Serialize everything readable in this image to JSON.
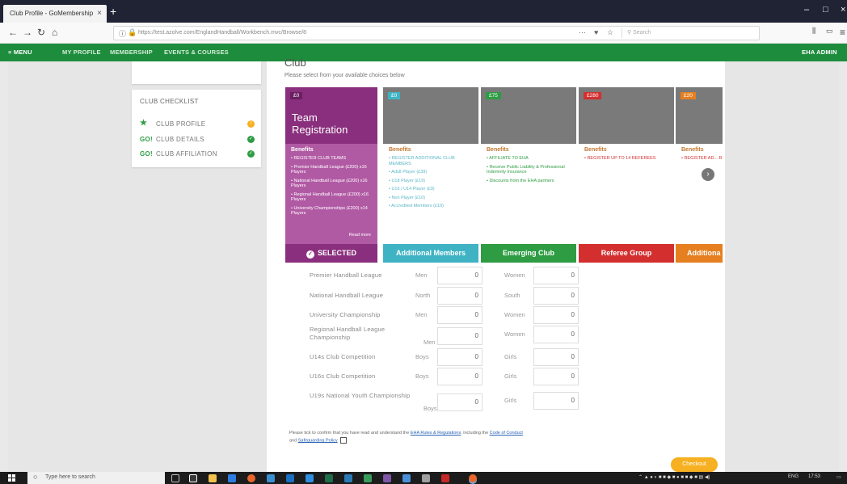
{
  "browser": {
    "tab_title": "Club Profile - GoMembership",
    "url": "https://test.azolve.com/EnglandHandball/Workbench.mvc/Browse/8",
    "search_placeholder": "Search"
  },
  "site_nav": {
    "menu": "MENU",
    "items": [
      "MY PROFILE",
      "MEMBERSHIP",
      "EVENTS & COURSES"
    ],
    "user": "EHA ADMIN"
  },
  "checklist": {
    "title": "CLUB CHECKLIST",
    "items": [
      {
        "icon": "★",
        "label": "CLUB PROFILE",
        "status": "warning",
        "color": "#f6b021"
      },
      {
        "icon": "GO!",
        "label": "CLUB DETAILS",
        "status": "ok",
        "color": "#2e9c43"
      },
      {
        "icon": "GO!",
        "label": "CLUB AFFILIATION",
        "status": "ok",
        "color": "#2e9c43"
      }
    ]
  },
  "main": {
    "heading": "Club",
    "subheading": "Please select from your available choices below"
  },
  "cards": {
    "team": {
      "price": "£0",
      "title_line1": "Team",
      "title_line2": "Registration",
      "benefits_heading": "Benefits",
      "benefits": [
        "• REGISTER CLUB TEAMS",
        "• Premier Handball League (£200) x16 Players",
        "• National Handball League (£200) x16 Players",
        "• Regional Handball League (£200) x16 Players",
        "• University Championships (£200) x14 Players"
      ],
      "read_more": "Read more",
      "footer": "SELECTED"
    },
    "additional": {
      "price": "£0",
      "benefits_heading": "Benefits",
      "benefits": [
        "• REGISTER ADDITIONAL CLUB MEMBERS",
        "• Adult Player (£39)",
        "• U18 Player (£19)",
        "• U16 / U14 Player (£9)",
        "• Non Player (£10)",
        "• Accredited Members (£10)"
      ],
      "footer": "Additional Members"
    },
    "emerging": {
      "price": "£75",
      "benefits_heading": "Benefits",
      "benefits": [
        "• AFFILIATE TO EHA",
        "• Receive Public Liability & Professional Indemnity Insurance",
        "• Discounts from the EHA partners"
      ],
      "footer": "Emerging Club"
    },
    "referee": {
      "price": "£280",
      "benefits_heading": "Benefits",
      "benefits": [
        "• REGISTER UP TO 14 REFEREES"
      ],
      "footer": "Referee Group"
    },
    "additional2": {
      "price": "£20",
      "benefits_heading": "Benefits",
      "benefits": [
        "• REGISTER AD... REFEREES"
      ],
      "footer": "Additiona"
    }
  },
  "form": {
    "rows": [
      {
        "label": "Premier Handball League",
        "sub1": "Men",
        "val1": "0",
        "sub2": "Women",
        "val2": "0"
      },
      {
        "label": "National Handball League",
        "sub1": "North",
        "val1": "0",
        "sub2": "South",
        "val2": "0"
      },
      {
        "label": "University Championship",
        "sub1": "Men",
        "val1": "0",
        "sub2": "Women",
        "val2": "0"
      },
      {
        "label": "Regional Handball League Championship",
        "sub1": "Men",
        "val1": "0",
        "sub2": "Women",
        "val2": "0"
      },
      {
        "label": "U14s Club Competition",
        "sub1": "Boys",
        "val1": "0",
        "sub2": "Girls",
        "val2": "0"
      },
      {
        "label": "U16s Club Competition",
        "sub1": "Boys",
        "val1": "0",
        "sub2": "Girls",
        "val2": "0"
      },
      {
        "label": "U19s National Youth Championship",
        "sub1": "Boys",
        "val1": "0",
        "sub2": "Girls",
        "val2": "0"
      }
    ]
  },
  "confirm": {
    "text1": "Please tick to confirm that you have read and understand the ",
    "link1": "EHA Rules & Regulations",
    "text2": ", including the ",
    "link2": "Code of Conduct",
    "text3": " and ",
    "link3": "Safeguarding Policy"
  },
  "checkout": "Checkout",
  "taskbar": {
    "search_placeholder": "Type here to search",
    "lang": "ENG",
    "time": "17:53"
  }
}
